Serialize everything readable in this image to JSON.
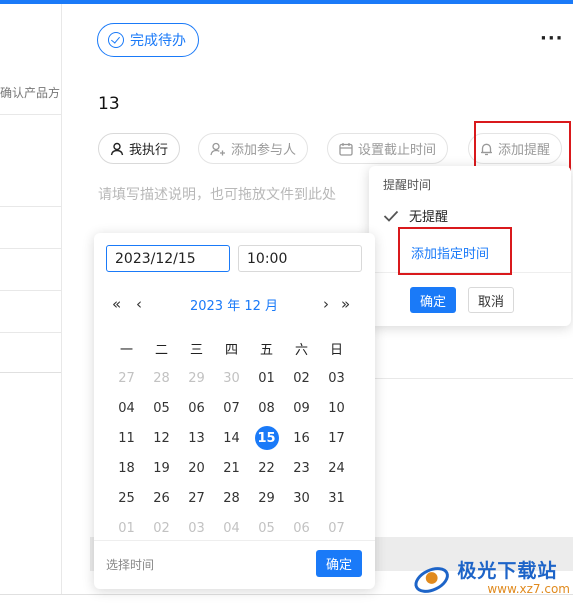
{
  "left_pane": {
    "column_header": "确认产品方"
  },
  "header": {
    "complete_label": "完成待办",
    "more_label": "···"
  },
  "task": {
    "title": "13",
    "description_placeholder": "请填写描述说明，也可拖放文件到此处"
  },
  "chips": {
    "assignee": "我执行",
    "add_participant": "添加参与人",
    "set_deadline": "设置截止时间",
    "add_reminder": "添加提醒"
  },
  "reminder_popup": {
    "title": "提醒时间",
    "no_reminder": "无提醒",
    "add_specific_time": "添加指定时间",
    "confirm": "确定",
    "cancel": "取消"
  },
  "date_picker": {
    "date_value": "2023/12/15",
    "time_value": "10:00",
    "month_label": "2023 年 12 月",
    "nav": {
      "prev_year": "«",
      "prev_month": "‹",
      "next_month": "›",
      "next_year": "»"
    },
    "weekdays": [
      "一",
      "二",
      "三",
      "四",
      "五",
      "六",
      "日"
    ],
    "weeks": [
      [
        {
          "d": "27",
          "other": true
        },
        {
          "d": "28",
          "other": true
        },
        {
          "d": "29",
          "other": true
        },
        {
          "d": "30",
          "other": true
        },
        {
          "d": "01"
        },
        {
          "d": "02"
        },
        {
          "d": "03"
        }
      ],
      [
        {
          "d": "04"
        },
        {
          "d": "05"
        },
        {
          "d": "06"
        },
        {
          "d": "07"
        },
        {
          "d": "08"
        },
        {
          "d": "09"
        },
        {
          "d": "10"
        }
      ],
      [
        {
          "d": "11"
        },
        {
          "d": "12"
        },
        {
          "d": "13"
        },
        {
          "d": "14"
        },
        {
          "d": "15",
          "selected": true
        },
        {
          "d": "16"
        },
        {
          "d": "17"
        }
      ],
      [
        {
          "d": "18"
        },
        {
          "d": "19"
        },
        {
          "d": "20"
        },
        {
          "d": "21"
        },
        {
          "d": "22"
        },
        {
          "d": "23"
        },
        {
          "d": "24"
        }
      ],
      [
        {
          "d": "25"
        },
        {
          "d": "26"
        },
        {
          "d": "27"
        },
        {
          "d": "28"
        },
        {
          "d": "29"
        },
        {
          "d": "30"
        },
        {
          "d": "31"
        }
      ],
      [
        {
          "d": "01",
          "other": true
        },
        {
          "d": "02",
          "other": true
        },
        {
          "d": "03",
          "other": true
        },
        {
          "d": "04",
          "other": true
        },
        {
          "d": "05",
          "other": true
        },
        {
          "d": "06",
          "other": true
        },
        {
          "d": "07",
          "other": true
        }
      ]
    ],
    "choose_time": "选择时间",
    "confirm": "确定"
  },
  "watermark": {
    "main": "极光下载站",
    "sub": "www.xz7.com"
  },
  "colors": {
    "accent": "#1a7af8",
    "highlight_box": "#d9191c"
  }
}
